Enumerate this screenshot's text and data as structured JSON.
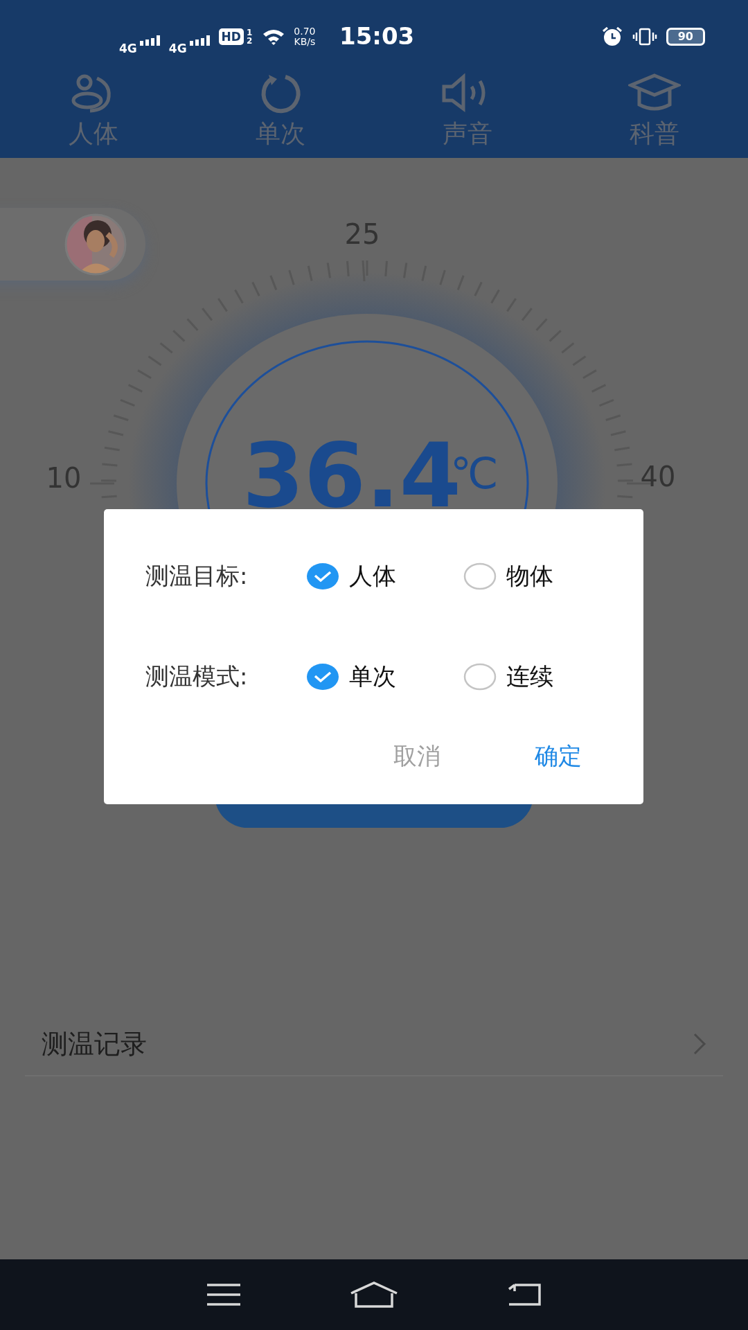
{
  "status_bar": {
    "network_1": "4G",
    "network_2": "4G",
    "hd": "HD",
    "hd_sub_1": "1",
    "hd_sub_2": "2",
    "speed_value": "0.70",
    "speed_unit": "KB/s",
    "time": "15:03",
    "battery": "90"
  },
  "tabs": [
    {
      "label": "人体"
    },
    {
      "label": "单次"
    },
    {
      "label": "声音"
    },
    {
      "label": "科普"
    }
  ],
  "gauge": {
    "scale_labels": [
      "10",
      "25",
      "40"
    ],
    "reading": "36.4",
    "unit": "℃"
  },
  "records": {
    "label": "测温记录"
  },
  "dialog": {
    "rows": [
      {
        "label": "测温目标:",
        "options": [
          {
            "label": "人体",
            "selected": true
          },
          {
            "label": "物体",
            "selected": false
          }
        ]
      },
      {
        "label": "测温模式:",
        "options": [
          {
            "label": "单次",
            "selected": true
          },
          {
            "label": "连续",
            "selected": false
          }
        ]
      }
    ],
    "cancel": "取消",
    "confirm": "确定"
  }
}
